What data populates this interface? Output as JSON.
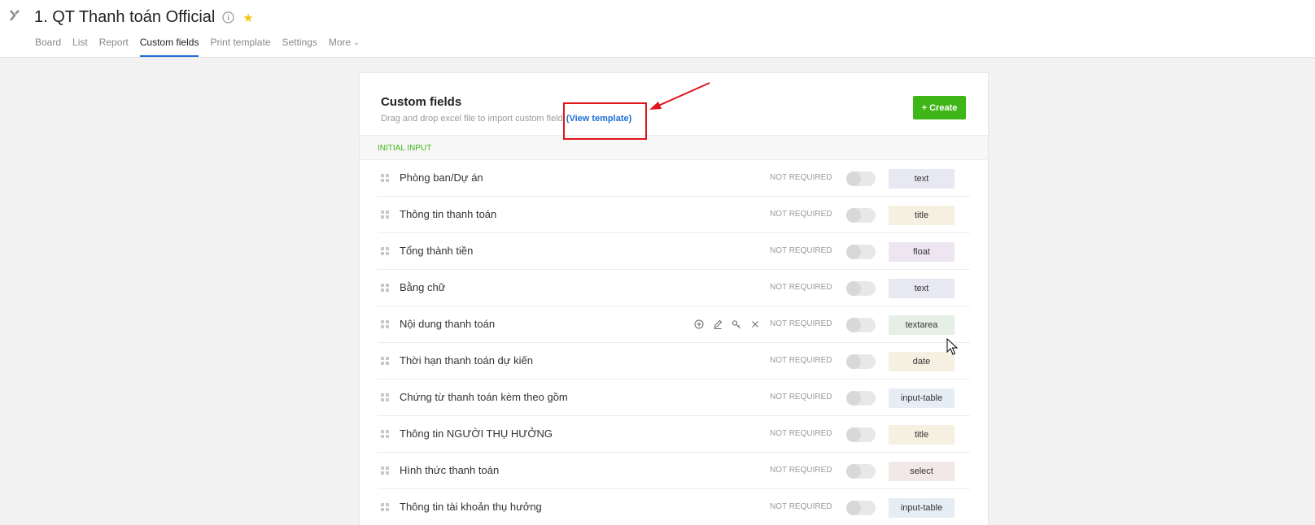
{
  "header": {
    "title": "1. QT Thanh toán Official",
    "tabs": [
      {
        "label": "Board"
      },
      {
        "label": "List"
      },
      {
        "label": "Report"
      },
      {
        "label": "Custom fields"
      },
      {
        "label": "Print template"
      },
      {
        "label": "Settings"
      },
      {
        "label": "More"
      }
    ]
  },
  "card": {
    "title": "Custom fields",
    "subtitle": "Drag and drop excel file to import custom field",
    "view_template": "(View template)",
    "create_label": "+ Create",
    "section_label": "INITIAL INPUT"
  },
  "fields": [
    {
      "name": "Phòng ban/Dự án",
      "required": "NOT REQUIRED",
      "type": "text",
      "type_color": "#e8e8f2"
    },
    {
      "name": "Thông tin thanh toán",
      "required": "NOT REQUIRED",
      "type": "title",
      "type_color": "#f5f0e2"
    },
    {
      "name": "Tổng thành tiền",
      "required": "NOT REQUIRED",
      "type": "float",
      "type_color": "#ede6f0"
    },
    {
      "name": "Bằng chữ",
      "required": "NOT REQUIRED",
      "type": "text",
      "type_color": "#e8e8f2"
    },
    {
      "name": "Nội dung thanh toán",
      "required": "NOT REQUIRED",
      "type": "textarea",
      "type_color": "#e6efe6"
    },
    {
      "name": "Thời hạn thanh toán dự kiến",
      "required": "NOT REQUIRED",
      "type": "date",
      "type_color": "#f5f0e2"
    },
    {
      "name": "Chứng từ thanh toán kèm theo gồm",
      "required": "NOT REQUIRED",
      "type": "input-table",
      "type_color": "#e6edf5"
    },
    {
      "name": "Thông tin NGƯỜI THỤ HƯỞNG",
      "required": "NOT REQUIRED",
      "type": "title",
      "type_color": "#f5f0e2"
    },
    {
      "name": "Hình thức thanh toán",
      "required": "NOT REQUIRED",
      "type": "select",
      "type_color": "#f3e8e8"
    },
    {
      "name": "Thông tin tài khoản thụ hưởng",
      "required": "NOT REQUIRED",
      "type": "input-table",
      "type_color": "#e6edf5"
    }
  ],
  "row_actions": [
    "add-circle-icon",
    "edit-icon",
    "key-icon",
    "close-icon"
  ],
  "colors": {
    "accent": "#1e6fd9",
    "create": "#3fb618",
    "annotation": "#e0141b"
  }
}
